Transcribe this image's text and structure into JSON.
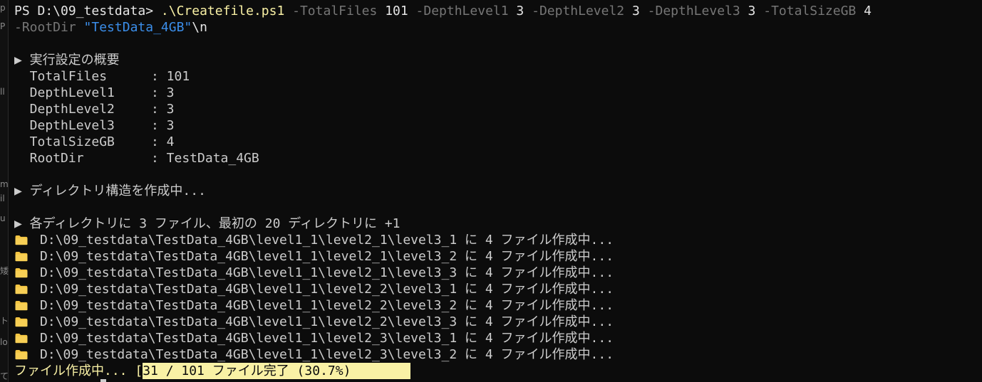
{
  "left_fragments": [
    "p",
    "P",
    "ll",
    "m",
    "il",
    "u",
    "矮",
    "ト",
    "lo",
    "て"
  ],
  "command": {
    "prompt": "PS D:\\09_testdata> ",
    "script": ".\\Createfile.ps1",
    "p1_name": " -TotalFiles ",
    "p1_value": "101",
    "p2_name": " -DepthLevel1 ",
    "p2_value": "3",
    "p3_name": " -DepthLevel2 ",
    "p3_value": "3",
    "p4_name": " -DepthLevel3 ",
    "p4_value": "3",
    "p5_name": " -TotalSizeGB ",
    "p5_value": "4",
    "p6_name": "-RootDir ",
    "p6_value": "\"TestData_4GB\"",
    "trailing": "\\n"
  },
  "settings": {
    "heading": "▶ 実行設定の概要",
    "rows": [
      {
        "key": "  TotalFiles",
        "value": ": 101"
      },
      {
        "key": "  DepthLevel1",
        "value": ": 3"
      },
      {
        "key": "  DepthLevel2",
        "value": ": 3"
      },
      {
        "key": "  DepthLevel3",
        "value": ": 3"
      },
      {
        "key": "  TotalSizeGB",
        "value": ": 4"
      },
      {
        "key": "  RootDir",
        "value": ": TestData_4GB"
      }
    ]
  },
  "dir_creation": "▶ ディレクトリ構造を作成中...",
  "distribution": "▶ 各ディレクトリに 3 ファイル、最初の 20 ディレクトリに +1",
  "folder_lines": [
    "D:\\09_testdata\\TestData_4GB\\level1_1\\level2_1\\level3_1 に 4 ファイル作成中...",
    "D:\\09_testdata\\TestData_4GB\\level1_1\\level2_1\\level3_2 に 4 ファイル作成中...",
    "D:\\09_testdata\\TestData_4GB\\level1_1\\level2_1\\level3_3 に 4 ファイル作成中...",
    "D:\\09_testdata\\TestData_4GB\\level1_1\\level2_2\\level3_1 に 4 ファイル作成中...",
    "D:\\09_testdata\\TestData_4GB\\level1_1\\level2_2\\level3_2 に 4 ファイル作成中...",
    "D:\\09_testdata\\TestData_4GB\\level1_1\\level2_2\\level3_3 に 4 ファイル作成中...",
    "D:\\09_testdata\\TestData_4GB\\level1_1\\level2_3\\level3_1 に 4 ファイル作成中...",
    "D:\\09_testdata\\TestData_4GB\\level1_1\\level2_3\\level3_2 に 4 ファイル作成中..."
  ],
  "progress": {
    "prefix": "ファイル作成中... [",
    "text": "31 / 101 ファイル完了 (30.7%)",
    "completed": 31,
    "total": 101,
    "percent": 30.7
  },
  "colors": {
    "background": "#0c0c0c",
    "foreground": "#cccccc",
    "script": "#f9f1a5",
    "param": "#767676",
    "string": "#3b8eea",
    "progress_bg": "#f9f1a5",
    "folder": "#f4c542"
  },
  "icons": {
    "folder": "folder-icon"
  }
}
